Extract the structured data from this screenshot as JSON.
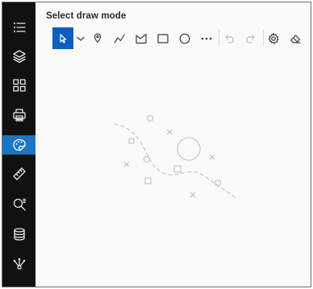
{
  "panel": {
    "title": "Select draw mode"
  },
  "sidebar": {
    "items": [
      {
        "name": "layer-list",
        "icon": "list-icon"
      },
      {
        "name": "layers",
        "icon": "layers-icon"
      },
      {
        "name": "basemap-gallery",
        "icon": "grid-icon"
      },
      {
        "name": "print",
        "icon": "printer-icon"
      },
      {
        "name": "sketch",
        "icon": "palette-icon",
        "active": true
      },
      {
        "name": "measure",
        "icon": "ruler-icon"
      },
      {
        "name": "search",
        "icon": "search-icon"
      },
      {
        "name": "data",
        "icon": "database-icon"
      },
      {
        "name": "share",
        "icon": "network-icon"
      }
    ]
  },
  "toolbar": {
    "tools": [
      {
        "name": "select",
        "icon": "cursor-icon",
        "active": true
      },
      {
        "name": "select-options",
        "icon": "chevron-down-icon"
      },
      {
        "name": "point",
        "icon": "pin-icon"
      },
      {
        "name": "polyline",
        "icon": "polyline-icon"
      },
      {
        "name": "polygon",
        "icon": "polygon-icon"
      },
      {
        "name": "rectangle",
        "icon": "rectangle-icon"
      },
      {
        "name": "circle",
        "icon": "circle-icon"
      },
      {
        "name": "more",
        "icon": "ellipsis-icon"
      },
      {
        "name": "undo",
        "icon": "undo-icon",
        "disabled": true
      },
      {
        "name": "redo",
        "icon": "redo-icon",
        "disabled": true
      },
      {
        "name": "settings",
        "icon": "gear-icon"
      },
      {
        "name": "clear",
        "icon": "eraser-icon"
      }
    ]
  },
  "colors": {
    "sidebar_bg": "#111111",
    "sidebar_active": "#1b74c5",
    "tool_active": "#0b5fbd",
    "panel_bg": "#fbfaf9"
  }
}
